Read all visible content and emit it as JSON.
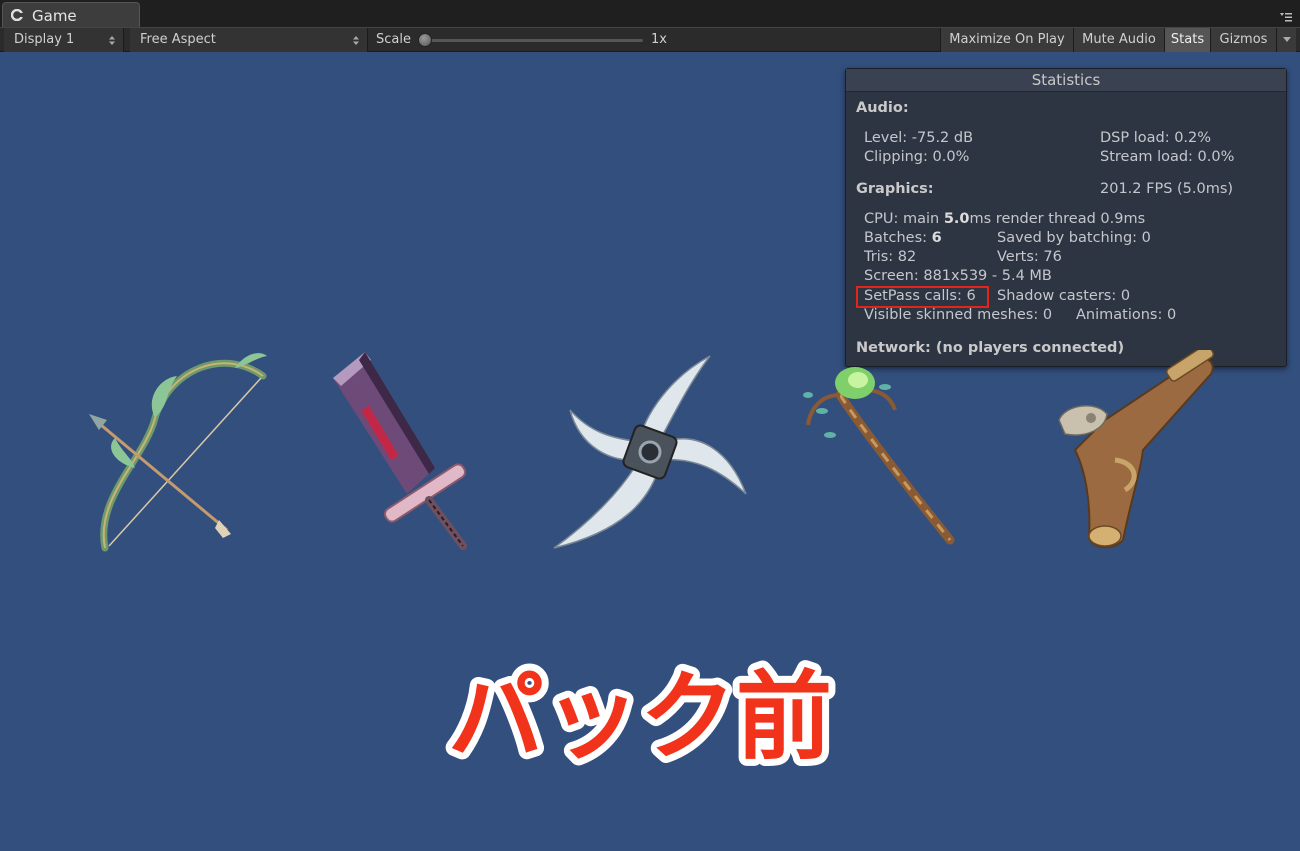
{
  "window": {
    "tab_label": "Game"
  },
  "toolbar": {
    "display": "Display 1",
    "aspect": "Free Aspect",
    "scale_label": "Scale",
    "scale_value": "1x",
    "scale_fraction": 0.0,
    "maximize": "Maximize On Play",
    "mute": "Mute Audio",
    "stats": "Stats",
    "gizmos": "Gizmos"
  },
  "stats": {
    "title": "Statistics",
    "audio_header": "Audio:",
    "level": "Level: -75.2 dB",
    "clipping": "Clipping: 0.0%",
    "dsp": "DSP load: 0.2%",
    "stream": "Stream load: 0.0%",
    "graphics_header": "Graphics:",
    "fps": "201.2 FPS (5.0ms)",
    "cpu_prefix": "CPU: main ",
    "cpu_main": "5.0",
    "cpu_suffix": "ms  render thread 0.9ms",
    "batches_prefix": "Batches: ",
    "batches": "6",
    "saved": "Saved by batching: 0",
    "tris": "Tris: 82",
    "verts": "Verts: 76",
    "screen": "Screen: 881x539 - 5.4 MB",
    "setpass": "SetPass calls: 6",
    "shadow": "Shadow casters: 0",
    "skinned": "Visible skinned meshes: 0",
    "animations": "Animations: 0",
    "network": "Network: (no players connected)"
  },
  "caption": "パック前",
  "colors": {
    "background": "#334f7e",
    "caption_fill": "#f0331a",
    "highlight": "#e3241a"
  },
  "icons": [
    "unity-logo-icon",
    "tab-menu-icon",
    "bow-icon",
    "sword-icon",
    "shuriken-icon",
    "staff-icon",
    "pistol-icon"
  ]
}
